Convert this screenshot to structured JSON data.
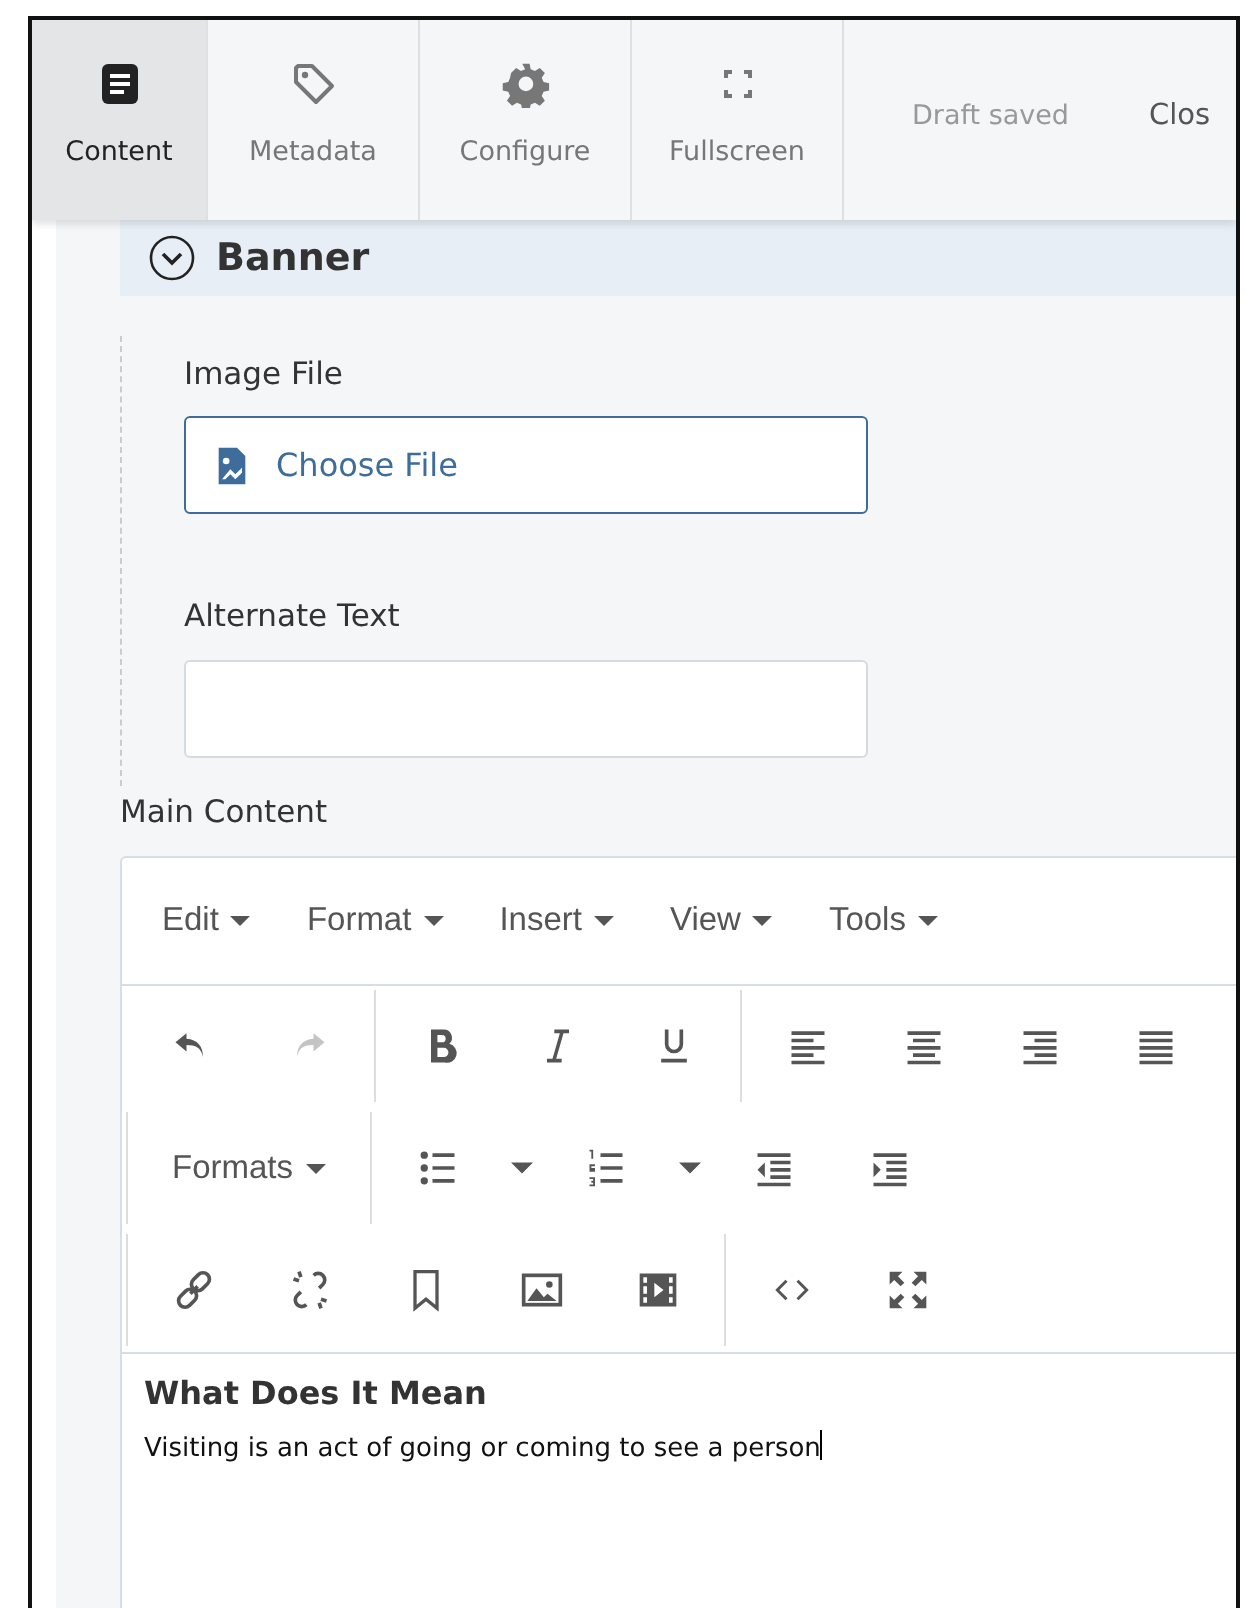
{
  "top_bar": {
    "tabs": [
      {
        "kind": "document",
        "label": "Content",
        "selected": true
      },
      {
        "kind": "tag",
        "label": "Metadata",
        "selected": false
      },
      {
        "kind": "gear",
        "label": "Configure",
        "selected": false
      },
      {
        "kind": "expand",
        "label": "Fullscreen",
        "selected": false
      }
    ],
    "status": "Draft saved",
    "close": "Clos"
  },
  "banner": {
    "title": "Banner",
    "expanded": true
  },
  "image_field": {
    "label": "Image File",
    "button": "Choose File"
  },
  "alt_field": {
    "label": "Alternate Text"
  },
  "main_content": {
    "label": "Main Content",
    "menus": [
      "Edit",
      "Format",
      "Insert",
      "View",
      "Tools"
    ],
    "toolbar_rows": [
      [
        [
          {
            "kind": "undo",
            "disabled": false
          },
          {
            "kind": "redo",
            "disabled": true
          }
        ],
        [
          {
            "kind": "bold",
            "disabled": false
          },
          {
            "kind": "italic",
            "disabled": false
          },
          {
            "kind": "underline",
            "disabled": false
          }
        ],
        [
          {
            "kind": "align-left",
            "disabled": false
          },
          {
            "kind": "align-center",
            "disabled": false
          },
          {
            "kind": "align-right",
            "disabled": false
          },
          {
            "kind": "justify",
            "disabled": false
          }
        ]
      ],
      [
        [
          {
            "kind": "dropdown",
            "label": "Formats",
            "disabled": false
          }
        ],
        [
          {
            "kind": "bullet-list",
            "disabled": false
          },
          {
            "kind": "caret",
            "disabled": false
          },
          {
            "kind": "numbered-list",
            "disabled": false
          },
          {
            "kind": "caret",
            "disabled": false
          },
          {
            "kind": "outdent",
            "disabled": false
          },
          {
            "kind": "indent",
            "disabled": false
          }
        ]
      ],
      [
        [
          {
            "kind": "link",
            "disabled": false
          },
          {
            "kind": "unlink",
            "disabled": false
          },
          {
            "kind": "bookmark",
            "disabled": false
          },
          {
            "kind": "image",
            "disabled": false
          },
          {
            "kind": "video",
            "disabled": false
          }
        ],
        [
          {
            "kind": "code",
            "disabled": false
          },
          {
            "kind": "fullscreen",
            "disabled": false
          }
        ]
      ]
    ],
    "body": {
      "heading": "What Does It Mean",
      "paragraph": "Visiting is an act of going or coming to see a person"
    }
  }
}
